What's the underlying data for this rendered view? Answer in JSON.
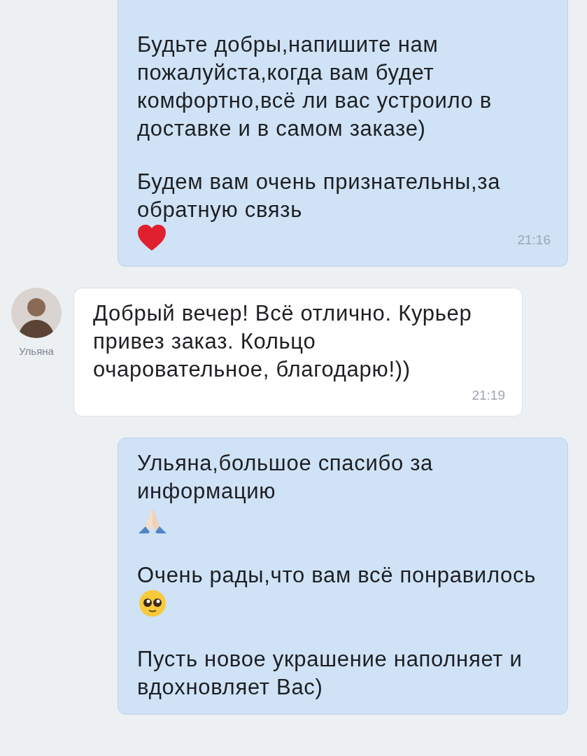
{
  "messages": [
    {
      "kind": "outgoing",
      "paragraphs": [
        {
          "kind": "plain",
          "text": "Будьте добры,напишите нам пожалуйста,когда вам будет комфортно,всё ли вас устроило в доставке и в самом заказе)"
        },
        {
          "kind": "with_heart",
          "text": "Будем вам очень признательны,за обратную связь"
        }
      ],
      "time": "21:16"
    },
    {
      "kind": "incoming",
      "author": "Ульяна",
      "paragraphs": [
        {
          "kind": "plain",
          "text": "Добрый вечер! Всё отлично. Курьер привез заказ. Кольцо очаровательное, благодарю!))"
        }
      ],
      "time": "21:19"
    },
    {
      "kind": "outgoing",
      "paragraphs": [
        {
          "kind": "with_praying_hands",
          "text": "Ульяна,большое спасибо за информацию"
        },
        {
          "kind": "with_pleading_face",
          "text": "Очень рады,что вам всё понравилось"
        },
        {
          "kind": "plain",
          "text": "Пусть новое украшение наполняет и вдохновляет Вас)"
        }
      ]
    }
  ]
}
